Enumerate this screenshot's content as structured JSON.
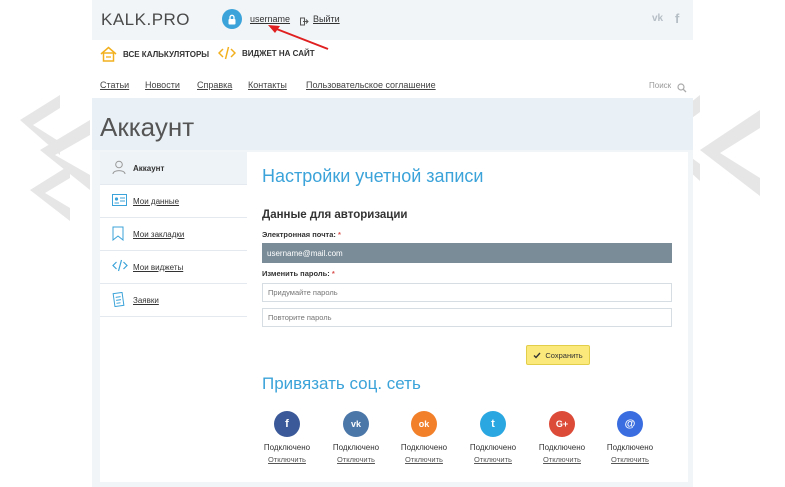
{
  "header": {
    "logo": "KALK.PRO",
    "username": "username",
    "logout": "Выйти",
    "social_vk": "vk",
    "social_fb": "f"
  },
  "topbar": {
    "calculators": "ВСЕ КАЛЬКУЛЯТОРЫ",
    "widget": "ВИДЖЕТ НА САЙТ"
  },
  "nav": {
    "items": [
      "Статьи",
      "Новости",
      "Справка",
      "Контакты",
      "Пользовательское соглашение"
    ],
    "search": "Поиск"
  },
  "page_title": "Аккаунт",
  "sidebar": {
    "items": [
      {
        "label": "Аккаунт",
        "icon": "user-icon"
      },
      {
        "label": "Мои данные",
        "icon": "id-card-icon"
      },
      {
        "label": "Мои закладки",
        "icon": "bookmark-icon"
      },
      {
        "label": "Мои виджеты",
        "icon": "code-icon"
      },
      {
        "label": "Заявки",
        "icon": "document-icon"
      }
    ]
  },
  "settings": {
    "title": "Настройки учетной записи",
    "auth_title": "Данные для авторизации",
    "email_label": "Электронная почта:",
    "email_value": "username@mail.com",
    "password_label": "Изменить пароль:",
    "required_mark": "*",
    "new_password_placeholder": "Придумайте пароль",
    "repeat_password_placeholder": "Повторите пароль",
    "save_label": "Сохранить"
  },
  "social": {
    "title": "Привязать соц. сеть",
    "networks": [
      {
        "name": "facebook",
        "glyph": "f",
        "color": "#3b5998",
        "status": "Подключено",
        "action": "Отключить"
      },
      {
        "name": "vkontakte",
        "glyph": "vk",
        "color": "#4a76a8",
        "status": "Подключено",
        "action": "Отключить"
      },
      {
        "name": "odnoklassniki",
        "glyph": "ok",
        "color": "#f2802a",
        "status": "Подключено",
        "action": "Отключить"
      },
      {
        "name": "twitter",
        "glyph": "t",
        "color": "#2aa7e0",
        "status": "Подключено",
        "action": "Отключить"
      },
      {
        "name": "google-plus",
        "glyph": "G+",
        "color": "#dc4a38",
        "status": "Подключено",
        "action": "Отключить"
      },
      {
        "name": "mailru",
        "glyph": "@",
        "color": "#3a6ee0",
        "status": "Подключено",
        "action": "Отключить"
      }
    ]
  },
  "colors": {
    "accent": "#3ba3d9",
    "email_field_bg": "#7a8c98",
    "save_button": "#fbe97c",
    "required": "#d9534f"
  }
}
